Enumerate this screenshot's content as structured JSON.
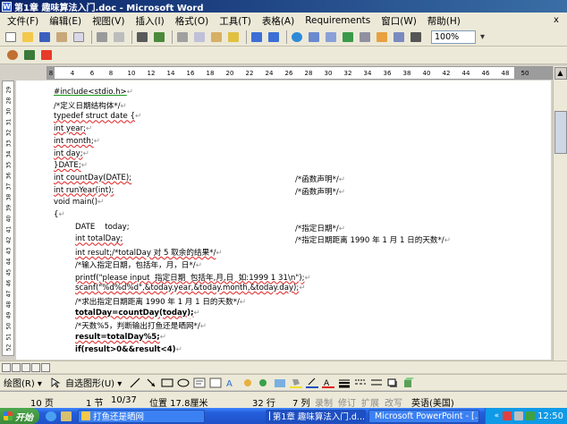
{
  "window": {
    "title": "第1章 趣味算法入门.doc - Microsoft Word",
    "close_doc_label": "x"
  },
  "menu": [
    "文件(F)",
    "编辑(E)",
    "视图(V)",
    "插入(I)",
    "格式(O)",
    "工具(T)",
    "表格(A)",
    "Requirements",
    "窗口(W)",
    "帮助(H)"
  ],
  "toolbar": {
    "zoom_value": "100%"
  },
  "ruler": {
    "ticks": [
      "8",
      "4",
      "6",
      "8",
      "10",
      "12",
      "14",
      "16",
      "18",
      "20",
      "22",
      "24",
      "26",
      "28",
      "30",
      "32",
      "34",
      "36",
      "38",
      "40",
      "42",
      "44",
      "46",
      "48",
      "50"
    ]
  },
  "vruler": {
    "ticks": [
      "29",
      "28",
      "30",
      "31",
      "32",
      "33",
      "34",
      "35",
      "36",
      "37",
      "38",
      "39",
      "40",
      "41",
      "42",
      "43",
      "44",
      "45",
      "46",
      "47",
      "48",
      "49",
      "50",
      "51",
      "52"
    ]
  },
  "document": {
    "lines": [
      {
        "text": "#include<stdio.h>",
        "style": "green"
      },
      {
        "text": "/*定义日期结构体*/",
        "style": ""
      },
      {
        "text": "typedef struct date {",
        "style": "squig"
      },
      {
        "text": "int year;",
        "style": "squig"
      },
      {
        "text": "int month;",
        "style": "squig"
      },
      {
        "text": "int day;",
        "style": "squig"
      },
      {
        "text": "}DATE;",
        "style": "squig"
      },
      {
        "text": "int countDay(DATE);",
        "style": "squig",
        "comment": "/*函数声明*/"
      },
      {
        "text": "int runYear(int);",
        "style": "squig",
        "comment": "/*函数声明*/"
      },
      {
        "text": "void main()",
        "style": ""
      },
      {
        "text": "{",
        "style": ""
      },
      {
        "text": "DATE    today;",
        "style": "",
        "indent": true,
        "comment": "/*指定日期*/"
      },
      {
        "text": "int totalDay;",
        "style": "squig",
        "indent": true,
        "comment": "/*指定日期距离 1990 年 1 月 1 日的天数*/"
      },
      {
        "text": "int result;/*totalDay 对 5 取余的结果*/",
        "style": "squig",
        "indent": true
      },
      {
        "text": "/*输入指定日期，包括年，月，日*/",
        "style": "",
        "indent": true
      },
      {
        "text": "printf(\"please input  指定日期  包括年,月,日  如:1999 1 31\\n\");",
        "style": "squig",
        "indent": true
      },
      {
        "text": "scanf(\"%d%d%d\",&today.year,&today.month,&today.day);",
        "style": "squig",
        "indent": true
      },
      {
        "text": "/*求出指定日期距离 1990 年 1 月 1 日的天数*/",
        "style": "",
        "indent": true
      },
      {
        "text": "totalDay=countDay(today);",
        "style": "bold-squig",
        "indent": true
      },
      {
        "text": "/*天数%5，判断输出打鱼还是晒网*/",
        "style": "",
        "indent": true
      },
      {
        "text": "result=totalDay%5;",
        "style": "bold-squig",
        "indent": true
      },
      {
        "text": "if(result>0&&result<4)",
        "style": "bold",
        "indent": true
      }
    ],
    "paragraph_mark": "↵"
  },
  "drawbar": {
    "draw_label": "绘图(R) ▾",
    "autoshape_label": "自选图形(U) ▾"
  },
  "status": {
    "page": "10 页",
    "section": "1 节",
    "pages": "10/37",
    "position": "位置 17.8厘米",
    "line": "32 行",
    "col": "7 列",
    "rec": "录制",
    "trk": "修订",
    "ext": "扩展",
    "ovr": "改写",
    "lang": "英语(美国)"
  },
  "taskbar": {
    "start": "开始",
    "tasks": [
      "打鱼还是晒网",
      "第1章 趣味算法入门.d...",
      "Microsoft PowerPoint - [..."
    ],
    "time": "12:50"
  },
  "colors": {
    "title_start": "#0a246a",
    "title_end": "#3a6ea5",
    "taskbar": "#245edb",
    "tray": "#0f9ae8"
  }
}
